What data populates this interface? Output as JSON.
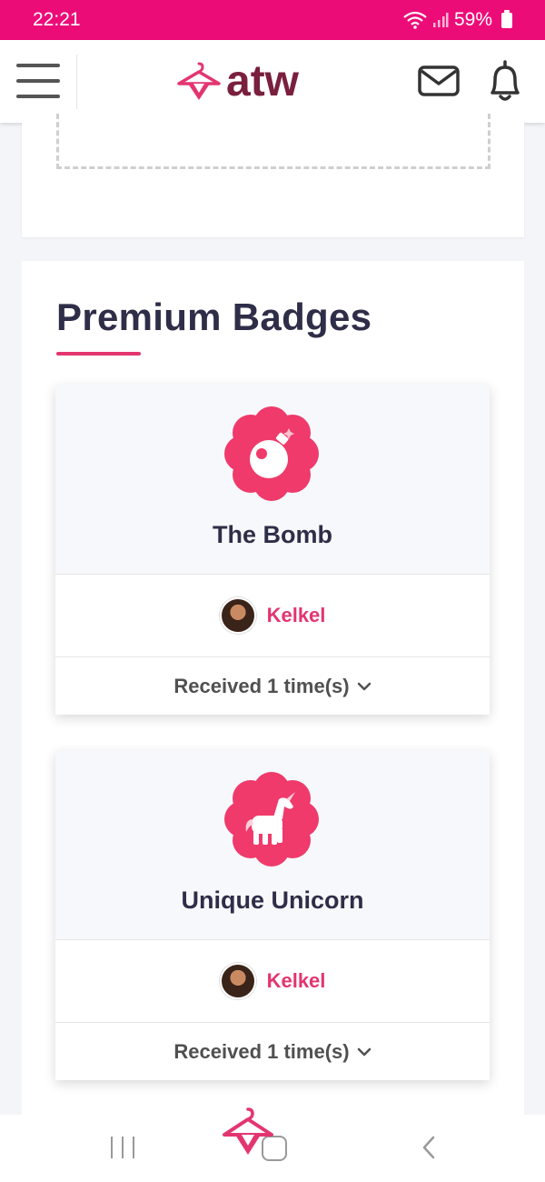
{
  "status_bar": {
    "time": "22:21",
    "battery": "59%"
  },
  "header": {
    "logo_text": "atw",
    "brand_color": "#7a1f3e",
    "accent_color": "#e3356f"
  },
  "section": {
    "title": "Premium Badges"
  },
  "badges": [
    {
      "name": "The Bomb",
      "icon": "bomb-icon",
      "user": "Kelkel",
      "received": "Received 1 time(s)"
    },
    {
      "name": "Unique Unicorn",
      "icon": "unicorn-icon",
      "user": "Kelkel",
      "received": "Received 1 time(s)"
    }
  ],
  "colors": {
    "status_bar_bg": "#ec0c78",
    "badge_pink": "#ef3a6b",
    "title_text": "#2e2e48"
  }
}
